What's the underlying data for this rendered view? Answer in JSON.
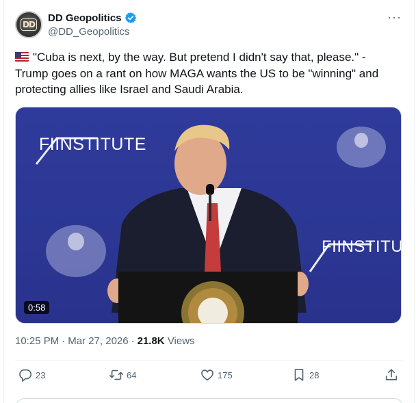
{
  "author": {
    "display_name": "DD Geopolitics",
    "handle": "@DD_Geopolitics",
    "verified": true,
    "avatar_text": "DD"
  },
  "post": {
    "text": "\"Cuba is next, by the way. But pretend I didn't say that, please.\" - Trump goes on a rant on how MAGA wants the US to be \"winning\" and protecting allies like Israel and Saudi Arabia."
  },
  "media": {
    "duration": "0:58",
    "backdrop_logo_text": "FIINSTITUTE",
    "backdrop_logo_text_2": "FIINSTITU"
  },
  "meta": {
    "time": "10:25 PM",
    "date": "Mar 27, 2026",
    "views_count": "21.8K",
    "views_label": "Views"
  },
  "actions": {
    "replies": "23",
    "reposts": "64",
    "likes": "175",
    "bookmarks": "28"
  },
  "colors": {
    "accent": "#1d9bf0",
    "secondary_text": "#536471",
    "media_background": "#2c3794"
  }
}
